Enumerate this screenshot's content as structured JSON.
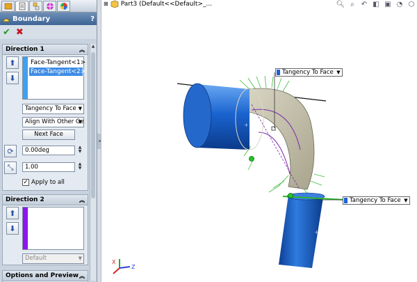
{
  "title": {
    "text": "Boundary",
    "help": "?"
  },
  "actions": {
    "ok": "✔",
    "cancel": "✖"
  },
  "direction1": {
    "header": "Direction 1",
    "items": [
      "Face-Tangent<1>",
      "Face-Tangent<2>"
    ],
    "tangency_type": "Tangency To Face",
    "alignment": "Align With Other Ge",
    "next_face": "Next Face",
    "angle": "0.00deg",
    "magnitude": "1.00",
    "apply_to_all": "Apply to all",
    "bar_color": "#3fa0ee"
  },
  "direction2": {
    "header": "Direction 2",
    "tangency_type": "Default",
    "bar_color": "#8f15ee"
  },
  "options": {
    "header": "Options and Preview"
  },
  "tree": {
    "label": "Part3  (Default<<Default>_..."
  },
  "viewport": {
    "callout1": "Tangency To Face",
    "callout2": "Tangency To Face",
    "axis_x": "X",
    "axis_z": "Z"
  },
  "icons": [
    "part-icon",
    "zoom-to-fit-icon",
    "zoom-area-icon",
    "previous-view-icon",
    "section-view-icon",
    "view-orientation-icon",
    "display-style-icon"
  ]
}
